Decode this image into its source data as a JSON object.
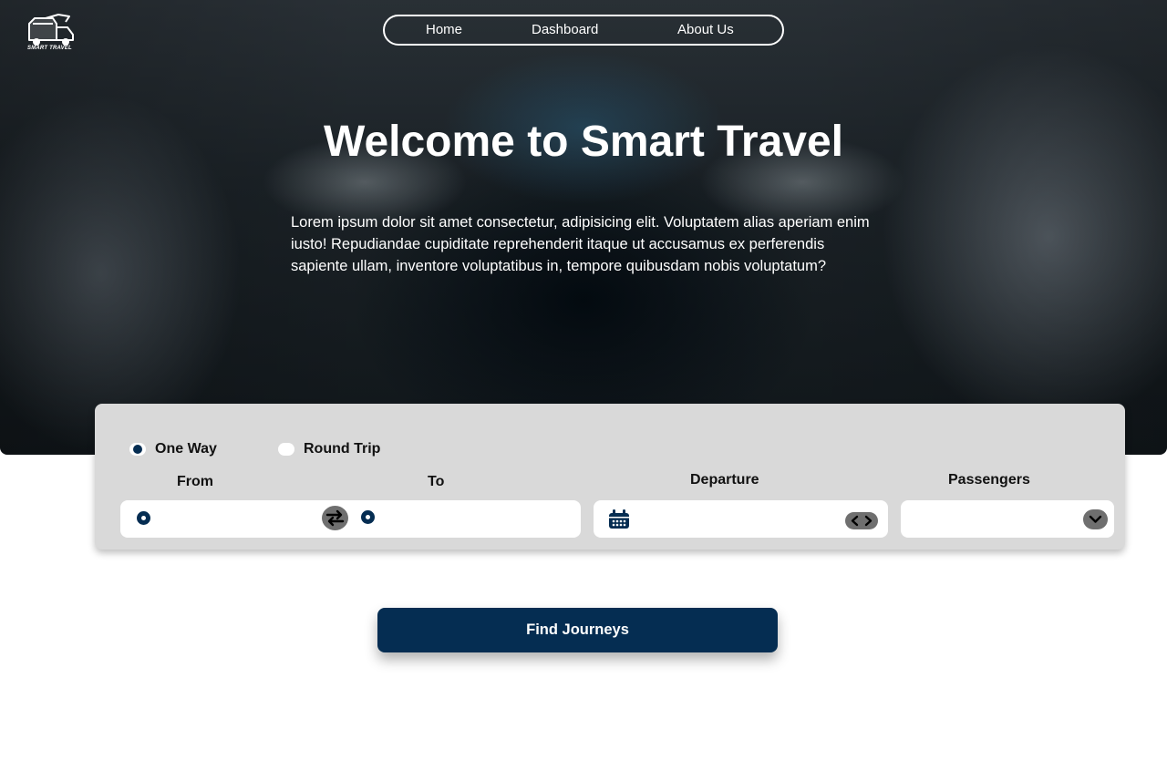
{
  "brand": {
    "logo_text": "SMART TRAVEL"
  },
  "nav": {
    "items": [
      "Home",
      "Dashboard",
      "About Us"
    ]
  },
  "hero": {
    "title": "Welcome to Smart Travel",
    "description": "Lorem ipsum dolor sit amet consectetur, adipisicing elit. Voluptatem alias aperiam enim iusto! Repudiandae cupiditate reprehenderit itaque ut accusamus ex perferendis sapiente ullam, inventore voluptatibus in, tempore quibusdam nobis voluptatum?"
  },
  "search": {
    "trip_types": [
      {
        "label": "One Way",
        "selected": true
      },
      {
        "label": "Round Trip",
        "selected": false
      }
    ],
    "labels": {
      "from": "From",
      "to": "To",
      "departure": "Departure",
      "passengers": "Passengers"
    },
    "values": {
      "from": "",
      "to": "",
      "departure": "",
      "passengers": ""
    },
    "icons": {
      "from": "location-pin-icon",
      "swap": "swap-arrows-icon",
      "to": "location-pin-icon",
      "departure": "calendar-icon",
      "date_stepper": "chevron-left-right-icon",
      "passengers": "chevron-down-icon"
    },
    "submit_label": "Find Journeys"
  },
  "colors": {
    "primary": "#052d52",
    "card_bg": "#d9d9d9",
    "control_grey": "#6f6f6f",
    "text_light": "#ffffff"
  }
}
